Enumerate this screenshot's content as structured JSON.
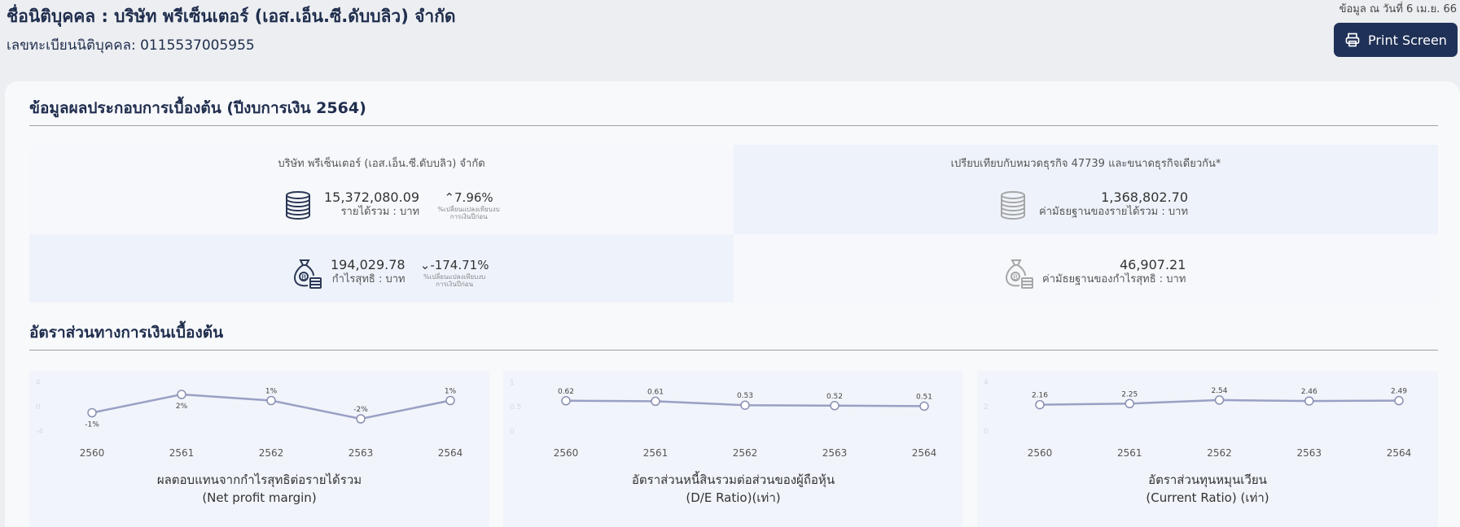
{
  "header": {
    "company_name": "ชื่อนิติบุคคล : บริษัท พรีเซ็นเตอร์ (เอส.เอ็น.ซี.ดับบลิว) จำกัด",
    "registration": "เลขทะเบียนนิติบุคคล: 0115537005955",
    "as_of": "ข้อมูล ณ วันที่ 6 เม.ย. 66",
    "print_label": "Print Screen"
  },
  "overview": {
    "title": "ข้อมูลผลประกอบการเบื้องต้น (ปีงบการเงิน 2564)",
    "company_panel_title": "บริษัท พรีเซ็นเตอร์ (เอส.เอ็น.ซี.ดับบลิว) จำกัด",
    "compare_panel_title": "เปรียบเทียบกับหมวดธุรกิจ 47739 และขนาดธุรกิจเดียวกัน*",
    "revenue": {
      "value": "15,372,080.09",
      "label": "รายได้รวม : บาท",
      "change": "7.96%",
      "direction": "up",
      "note": "%เปลี่ยนแปลงเทียบงบการเงินปีก่อน"
    },
    "net_profit": {
      "value": "194,029.78",
      "label": "กำไรสุทธิ : บาท",
      "change": "-174.71%",
      "direction": "down",
      "note": "%เปลี่ยนแปลงเทียบงบการเงินปีก่อน"
    },
    "median_revenue": {
      "value": "1,368,802.70",
      "label": "ค่ามัธยฐานของรายได้รวม : บาท"
    },
    "median_profit": {
      "value": "46,907.21",
      "label": "ค่ามัธยฐานของกำไรสุทธิ : บาท"
    }
  },
  "ratios": {
    "title": "อัตราส่วนทางการเงินเบื้องต้น"
  },
  "colors": {
    "navy": "#1f3157",
    "line": "#9aa0c4",
    "panel_tint": "#eef3fb"
  },
  "chart_data": [
    {
      "type": "line",
      "x": [
        "2560",
        "2561",
        "2562",
        "2563",
        "2564"
      ],
      "values": [
        -1,
        2,
        1,
        -2,
        1
      ],
      "labels": [
        "-1%",
        "2%",
        "1%",
        "-2%",
        "1%"
      ],
      "label_pos": [
        "below",
        "below",
        "above",
        "above",
        "above"
      ],
      "yticks": [
        "4",
        "0",
        "-4"
      ],
      "ylim": [
        -4,
        4
      ],
      "caption1": "ผลตอบแทนจากกำไรสุทธิต่อรายได้รวม",
      "caption2": "(Net profit margin)"
    },
    {
      "type": "line",
      "x": [
        "2560",
        "2561",
        "2562",
        "2563",
        "2564"
      ],
      "values": [
        0.62,
        0.61,
        0.53,
        0.52,
        0.51
      ],
      "labels": [
        "0.62",
        "0.61",
        "0.53",
        "0.52",
        "0.51"
      ],
      "label_pos": [
        "above",
        "above",
        "above",
        "above",
        "above"
      ],
      "yticks": [
        "1",
        "0.5",
        "0"
      ],
      "ylim": [
        0,
        1
      ],
      "caption1": "อัตราส่วนหนี้สินรวมต่อส่วนของผู้ถือหุ้น",
      "caption2": "(D/E Ratio)(เท่า)"
    },
    {
      "type": "line",
      "x": [
        "2560",
        "2561",
        "2562",
        "2563",
        "2564"
      ],
      "values": [
        2.16,
        2.25,
        2.54,
        2.46,
        2.49
      ],
      "labels": [
        "2.16",
        "2.25",
        "2.54",
        "2.46",
        "2.49"
      ],
      "label_pos": [
        "above",
        "above",
        "above",
        "above",
        "above"
      ],
      "yticks": [
        "4",
        "2",
        "0"
      ],
      "ylim": [
        0,
        4
      ],
      "caption1": "อัตราส่วนทุนหมุนเวียน",
      "caption2": "(Current Ratio) (เท่า)"
    }
  ]
}
